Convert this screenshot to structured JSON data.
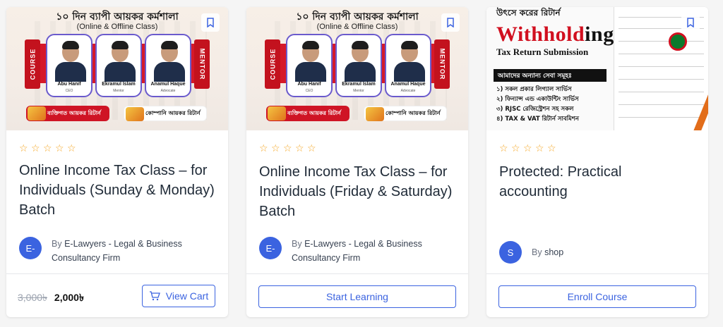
{
  "colors": {
    "accent": "#3b63e0",
    "star": "#f5a623",
    "banner_red": "#d5192a"
  },
  "courses": [
    {
      "thumbnail": {
        "kind": "class-banner",
        "headline": "১০ দিন ব্যাপী আয়কর কর্মশালা",
        "subline": "(Online & Offline Class)",
        "tag_left": "COURSE",
        "tag_right": "MENTOR",
        "mentors": [
          {
            "name": "Abu Hanif",
            "role": "CEO"
          },
          {
            "name": "Ekramul Islam",
            "role": "Mentor"
          },
          {
            "name": "Anamul Haque",
            "role": "Advocate"
          }
        ],
        "pill_1": "ব্যক্তিগত আয়কর রিটার্ন",
        "pill_2": "কোম্পানি আয়কর রিটার্ন"
      },
      "rating_icon": "star-outline-icon",
      "title": "Online Income Tax Class – for Individuals (Sunday & Monday) Batch",
      "author_initial": "E-",
      "author_prefix": "By",
      "author_name": "E-Lawyers - Legal & Business Consultancy Firm",
      "price_old": "3,000৳",
      "price_new": "2,000৳",
      "button_label": "View Cart",
      "button_icon": "cart-icon"
    },
    {
      "thumbnail": {
        "kind": "class-banner",
        "headline": "১০ দিন ব্যাপী আয়কর কর্মশালা",
        "subline": "(Online & Offline Class)",
        "tag_left": "COURSE",
        "tag_right": "MENTOR",
        "mentors": [
          {
            "name": "Abu Hanif",
            "role": "CEO"
          },
          {
            "name": "Ekramul Islam",
            "role": "Mentor"
          },
          {
            "name": "Anamul Haque",
            "role": "Advocate"
          }
        ],
        "pill_1": "ব্যক্তিগত আয়কর রিটার্ন",
        "pill_2": "কোম্পানি আয়কর রিটার্ন"
      },
      "rating_icon": "star-outline-icon",
      "title": "Online Income Tax Class – for Individuals (Friday & Saturday) Batch",
      "author_initial": "E-",
      "author_prefix": "By",
      "author_name": "E-Lawyers - Legal & Business Consultancy Firm",
      "button_label": "Start Learning"
    },
    {
      "thumbnail": {
        "kind": "withholding",
        "top_line": "উৎসে করের রিটার্ন",
        "big_red": "Withhold",
        "big_black": "ing",
        "sub": "Tax Return Submission",
        "bar": "আমাদের অন্যান্য সেবা সমূহঃ",
        "list": [
          "১) সকল প্রকার লিগ্যাল সার্ভিস",
          "২) ফিন্যান্স এন্ড একাউন্টিং সার্ভিস",
          "৩) RJSC রেজিস্ট্রেশন সহ সকল",
          "৪) TAX & VAT রিটার্ন সাবমিশন"
        ]
      },
      "rating_icon": "star-outline-icon",
      "title": "Protected: Practical accounting",
      "author_initial": "S",
      "author_prefix": "By",
      "author_name": "shop",
      "button_label": "Enroll Course"
    }
  ]
}
